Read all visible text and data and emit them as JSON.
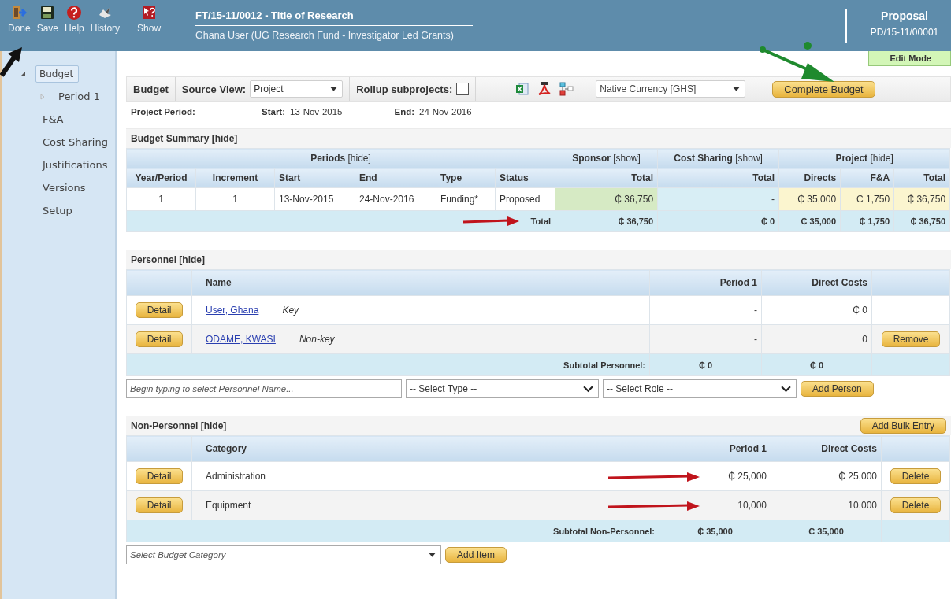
{
  "toolbar": [
    {
      "label": "Done"
    },
    {
      "label": "Save"
    },
    {
      "label": "Help"
    },
    {
      "label": "History"
    },
    {
      "label": "Show"
    }
  ],
  "header": {
    "title": "FT/15-11/0012 - Title of Research",
    "subtitle": "Ghana User (UG Research Fund - Investigator Led Grants)",
    "record_type": "Proposal",
    "record_id": "PD/15-11/00001",
    "mode": "Edit Mode"
  },
  "sidebar": {
    "items": [
      {
        "label": "Budget",
        "selected": true,
        "expanded": true,
        "children": [
          {
            "label": "Period 1",
            "selected": false,
            "expanded": false
          }
        ]
      },
      {
        "label": "F&A",
        "selected": false
      },
      {
        "label": "Cost Sharing",
        "selected": false
      },
      {
        "label": "Justifications",
        "selected": false
      },
      {
        "label": "Versions",
        "selected": false
      },
      {
        "label": "Setup",
        "selected": false
      }
    ]
  },
  "budget_bar": {
    "title": "Budget",
    "source_view_label": "Source View:",
    "source_view": "Project",
    "rollup_label": "Rollup subprojects:",
    "rollup_checked": false,
    "currency": "Native Currency [GHS]",
    "complete_button": "Complete Budget"
  },
  "project_period": {
    "label": "Project Period:",
    "start_label": "Start:",
    "start": "13-Nov-2015",
    "end_label": "End:",
    "end": "24-Nov-2016"
  },
  "budget_summary": {
    "title": "Budget Summary [hide]",
    "groups": [
      "**Periods** [hide]",
      "**Sponsor** [show]",
      "**Cost Sharing** [show]",
      "**Project** [hide]"
    ],
    "columns": [
      "Year/Period",
      "Increment",
      "Start",
      "End",
      "Type",
      "Status",
      "Total",
      "Total",
      "Directs",
      "F&A",
      "Total"
    ],
    "rows": [
      [
        "1",
        "1",
        "13-Nov-2015",
        "24-Nov-2016",
        "Funding*",
        "Proposed",
        "₵ 36,750",
        "-",
        "₵ 35,000",
        "₵ 1,750",
        "₵ 36,750"
      ]
    ],
    "total_label": "Total",
    "totals": [
      "₵ 36,750",
      "₵ 0",
      "₵ 35,000",
      "₵ 1,750",
      "₵ 36,750"
    ]
  },
  "personnel": {
    "title": "Personnel [hide]",
    "columns": [
      "Name",
      "Period 1",
      "Direct Costs"
    ],
    "rows": [
      {
        "detail": "Detail",
        "name": "User, Ghana",
        "role": "Key",
        "period_1": "-",
        "direct_costs": "₵ 0"
      },
      {
        "detail": "Detail",
        "name": "ODAME, KWASI",
        "role": "Non-key",
        "period_1": "-",
        "direct_costs": "0",
        "remove": "Remove"
      }
    ],
    "subtotal_label": "Subtotal Personnel:",
    "subtotal": [
      "₵ 0",
      "₵ 0"
    ],
    "name_placeholder": "Begin typing to select Personnel Name...",
    "type_select": "-- Select Type --",
    "role_select": "-- Select Role --",
    "add_button": "Add Person"
  },
  "non_personnel": {
    "title": "Non-Personnel [hide]",
    "bulk_button": "Add Bulk Entry",
    "columns": [
      "Category",
      "Period 1",
      "Direct Costs"
    ],
    "rows": [
      {
        "detail": "Detail",
        "category": "Administration",
        "period_1": "₵ 25,000",
        "direct_costs": "₵ 25,000",
        "delete": "Delete"
      },
      {
        "detail": "Detail",
        "category": "Equipment",
        "period_1": "10,000",
        "direct_costs": "10,000",
        "delete": "Delete"
      }
    ],
    "subtotal_label": "Subtotal Non-Personnel:",
    "subtotal": [
      "₵ 35,000",
      "₵ 35,000"
    ],
    "category_placeholder": "Select Budget Category",
    "add_button": "Add Item"
  }
}
